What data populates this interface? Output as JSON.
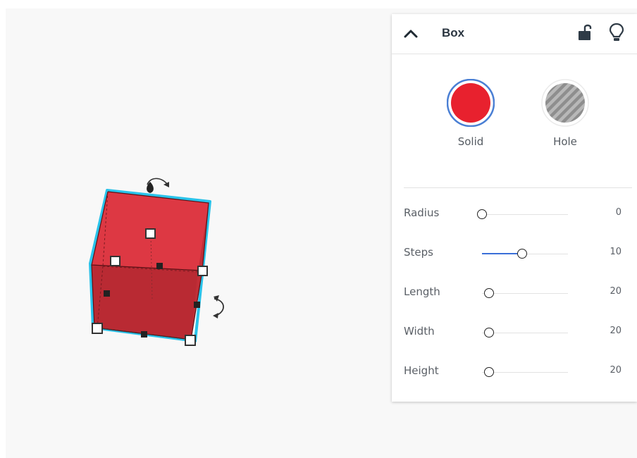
{
  "inspector": {
    "title": "Box",
    "types": [
      {
        "label": "Solid",
        "selected": true,
        "color": "#e8212e"
      },
      {
        "label": "Hole",
        "selected": false,
        "color": "#9a9a9a"
      }
    ],
    "params": [
      {
        "label": "Radius",
        "value": "0",
        "level": 0.0
      },
      {
        "label": "Steps",
        "value": "10",
        "level": 0.47
      },
      {
        "label": "Length",
        "value": "20",
        "level": 0.08
      },
      {
        "label": "Width",
        "value": "20",
        "level": 0.08
      },
      {
        "label": "Height",
        "value": "20",
        "level": 0.08
      }
    ]
  },
  "colors": {
    "accent": "#3a6fd8",
    "selection_outline": "#29c3ea",
    "box_red": "#d8323f"
  },
  "icons": [
    "chevron-up-icon",
    "unlock-icon",
    "lightbulb-icon",
    "rotate-arrow-icon"
  ]
}
